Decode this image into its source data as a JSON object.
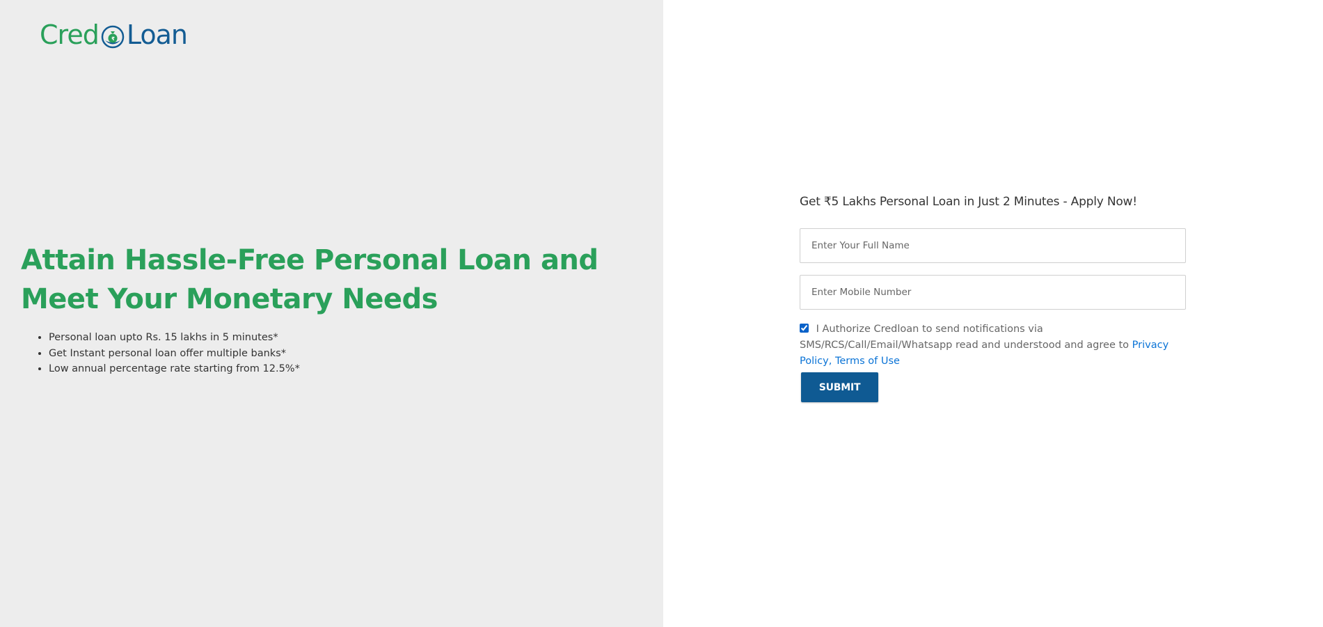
{
  "brand": {
    "logo_part1": "Cred",
    "logo_part2": "Loan",
    "logo_icon": "money-bag-icon",
    "colors": {
      "green": "#2aa05a",
      "blue": "#135c93",
      "left_bg": "#ededed",
      "button_bg": "#0f5a93",
      "link": "#0a73d6"
    }
  },
  "hero": {
    "title": "Attain Hassle-Free Personal Loan and Meet Your Monetary Needs",
    "features": [
      "Personal loan upto Rs. 15 lakhs in 5 minutes*",
      "Get Instant personal loan offer multiple banks*",
      "Low annual percentage rate starting from 12.5%*"
    ]
  },
  "form": {
    "heading": "Get ₹5 Lakhs Personal Loan in Just 2 Minutes - Apply Now!",
    "name_placeholder": "Enter Your Full Name",
    "name_value": "",
    "mobile_placeholder": "Enter Mobile Number",
    "mobile_value": "",
    "consent_checked": true,
    "consent_text": "I Authorize Credloan to send notifications via SMS/RCS/Call/Email/Whatsapp read and understood and agree to",
    "privacy_link": "Privacy Policy,",
    "terms_link": "Terms of Use",
    "submit_label": "SUBMIT"
  }
}
